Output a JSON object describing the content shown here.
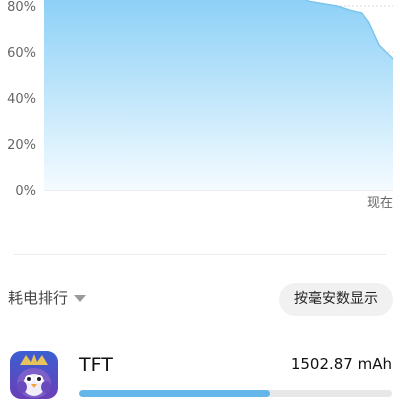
{
  "chart_data": {
    "type": "area",
    "y_ticks": [
      "0%",
      "20%",
      "40%",
      "60%",
      "80%"
    ],
    "ylim": [
      0,
      80
    ],
    "x_ticks": [
      "现在"
    ],
    "points": [
      {
        "x": 0.0,
        "y": 100
      },
      {
        "x": 0.15,
        "y": 100
      },
      {
        "x": 0.3,
        "y": 100
      },
      {
        "x": 0.45,
        "y": 100
      },
      {
        "x": 0.6,
        "y": 100
      },
      {
        "x": 0.74,
        "y": 100
      },
      {
        "x": 0.76,
        "y": 82
      },
      {
        "x": 0.8,
        "y": 81
      },
      {
        "x": 0.84,
        "y": 80
      },
      {
        "x": 0.88,
        "y": 78
      },
      {
        "x": 0.91,
        "y": 77
      },
      {
        "x": 0.93,
        "y": 73
      },
      {
        "x": 0.96,
        "y": 63
      },
      {
        "x": 0.98,
        "y": 60
      },
      {
        "x": 1.0,
        "y": 57
      }
    ],
    "colors": {
      "line": "#7cc4ee",
      "fill_top": "#8cd0f7",
      "fill_bottom": "#f4fbff",
      "grid": "#d8d8d8"
    },
    "grid": true
  },
  "ranking": {
    "sort_label": "耗电排行",
    "toggle_label": "按毫安数显示"
  },
  "apps": [
    {
      "name": "TFT",
      "usage": "1502.87 mAh",
      "share": 0.61,
      "icon": "tft-app-icon"
    }
  ]
}
